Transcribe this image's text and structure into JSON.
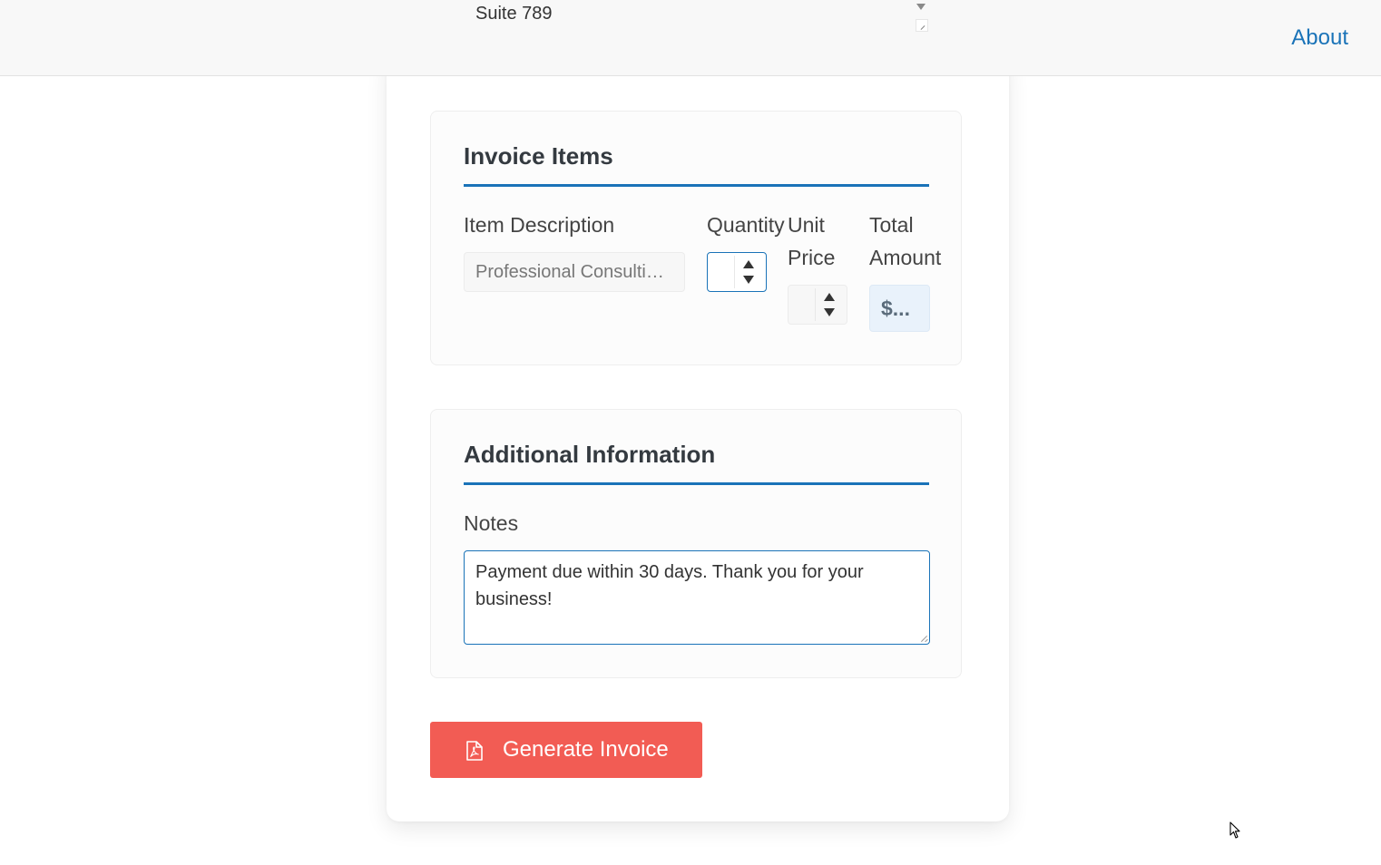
{
  "header": {
    "address_line": "Suite 789",
    "about_link": "About"
  },
  "invoice_items": {
    "title": "Invoice Items",
    "columns": {
      "description": "Item Description",
      "quantity": "Quantity",
      "unit_price_line1": "Unit",
      "unit_price_line2": "Price",
      "total_line1": "Total",
      "total_line2": "Amount"
    },
    "row": {
      "description_value": "Professional Consulting Services",
      "quantity_value": "",
      "unit_price_value": "",
      "total_value": "$..."
    }
  },
  "additional_info": {
    "title": "Additional Information",
    "notes_label": "Notes",
    "notes_value": "Payment due within 30 days. Thank you for your business!"
  },
  "actions": {
    "generate_label": "Generate Invoice",
    "generate_icon": "pdf-file-icon"
  },
  "colors": {
    "accent": "#1a73b8",
    "button": "#f25c54",
    "total_bg": "#e9f2fb"
  }
}
